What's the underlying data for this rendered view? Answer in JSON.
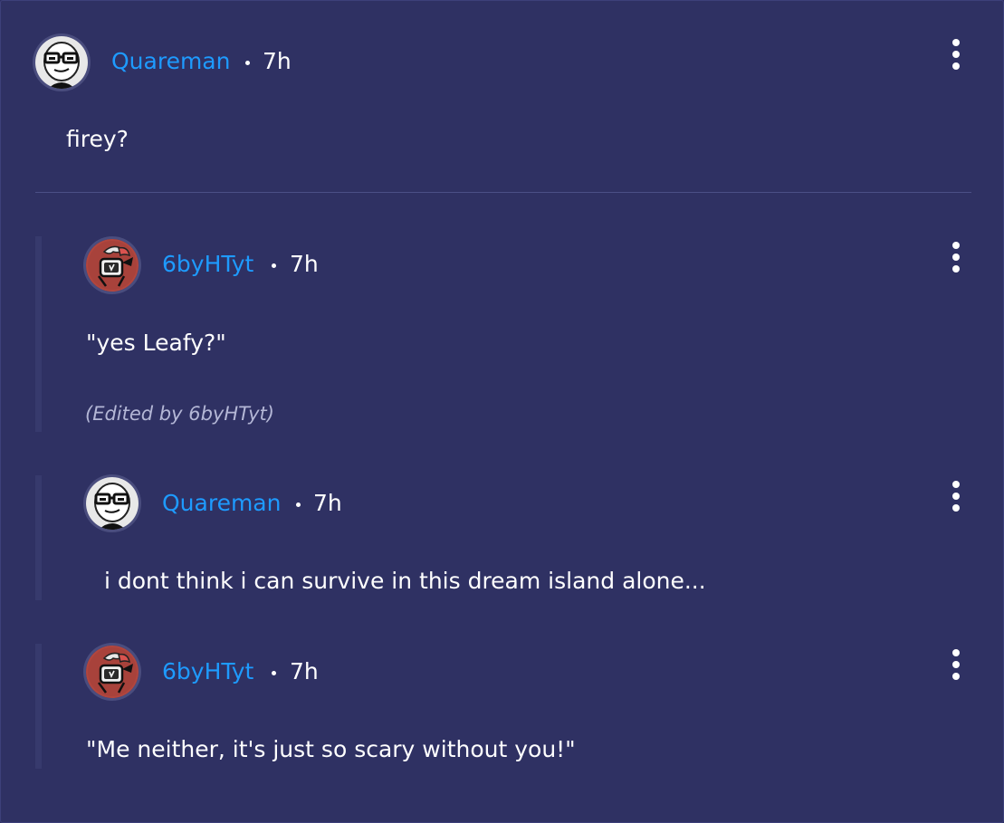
{
  "comments": [
    {
      "username": "Quareman",
      "separator": "•",
      "time": "7h",
      "text": "firey?",
      "avatar_icon": "glasses-face-avatar-icon"
    },
    {
      "username": "6byHTyt",
      "separator": "•",
      "time": "7h",
      "text": "\"yes Leafy?\"",
      "edited_note": "(Edited by 6byHTyt)",
      "avatar_icon": "red-character-avatar-icon"
    },
    {
      "username": "Quareman",
      "separator": "•",
      "time": "7h",
      "text": "i dont think i can survive in this dream island alone...",
      "avatar_icon": "glasses-face-avatar-icon"
    },
    {
      "username": "6byHTyt",
      "separator": "•",
      "time": "7h",
      "text": "\"Me neither, it's just so scary without you!\"",
      "avatar_icon": "red-character-avatar-icon"
    }
  ],
  "colors": {
    "background": "#2f3163",
    "username": "#1e9bff",
    "text": "#ffffff",
    "edited": "#b4b7d6",
    "thread_line": "#373a6d"
  },
  "menu_icon": "more-vertical-icon"
}
